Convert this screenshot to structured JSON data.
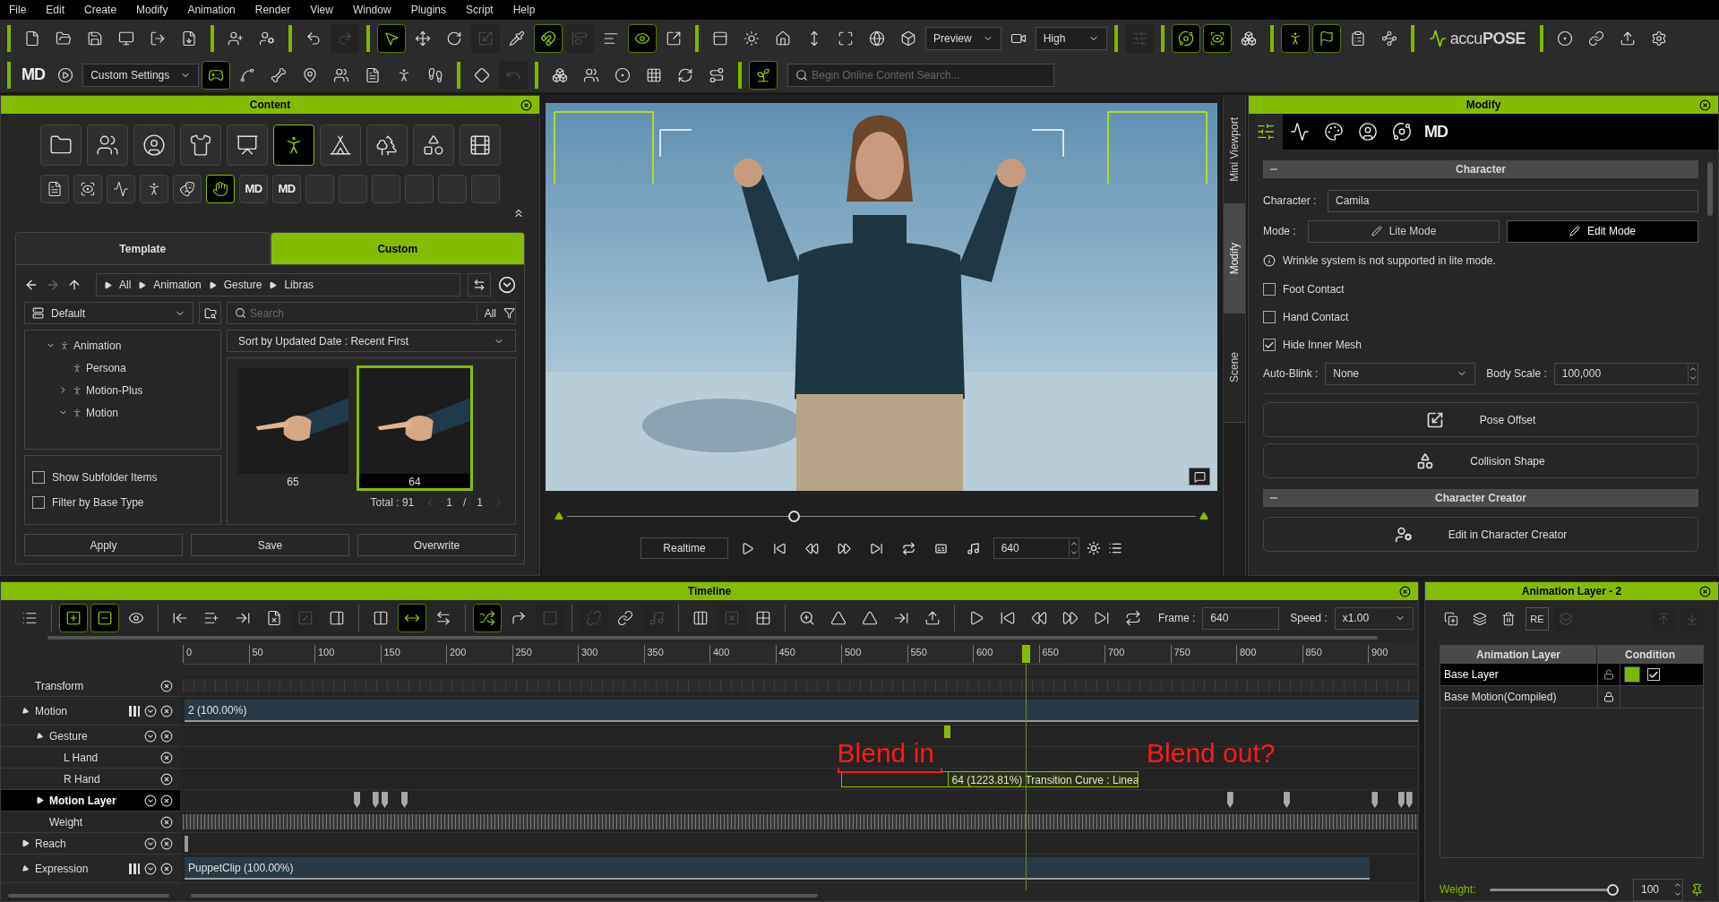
{
  "menu": [
    "File",
    "Edit",
    "Create",
    "Modify",
    "Animation",
    "Render",
    "View",
    "Window",
    "Plugins",
    "Script",
    "Help"
  ],
  "toolbar_1": [
    [
      {
        "kind": "icon",
        "on": false,
        "disabled": false
      },
      {
        "kind": "icon",
        "on": false,
        "disabled": false
      },
      {
        "kind": "icon",
        "on": false,
        "disabled": false
      },
      {
        "kind": "icon",
        "on": false,
        "disabled": false
      },
      {
        "kind": "icon",
        "on": false,
        "disabled": false
      },
      {
        "kind": "icon",
        "on": false,
        "disabled": false
      }
    ],
    [
      {
        "kind": "icon",
        "on": false,
        "disabled": false
      },
      {
        "kind": "icon",
        "on": false,
        "disabled": false
      }
    ],
    [
      {
        "kind": "icon",
        "on": false,
        "disabled": false
      },
      {
        "kind": "icon",
        "on": false,
        "disabled": true
      }
    ],
    [
      {
        "kind": "icon",
        "on": true,
        "disabled": false
      },
      {
        "kind": "icon",
        "on": false,
        "disabled": false
      },
      {
        "kind": "icon",
        "on": false,
        "disabled": false
      },
      {
        "kind": "icon",
        "on": false,
        "disabled": true
      },
      {
        "kind": "icon",
        "on": false,
        "disabled": false
      },
      {
        "kind": "icon",
        "on": true,
        "disabled": false
      },
      {
        "kind": "icon",
        "on": false,
        "disabled": true
      },
      {
        "kind": "icon",
        "on": false,
        "disabled": false
      },
      {
        "kind": "icon",
        "on": true,
        "disabled": false
      },
      {
        "kind": "icon",
        "on": false,
        "disabled": false
      }
    ],
    [
      {
        "kind": "icon",
        "on": false,
        "disabled": false
      },
      {
        "kind": "icon",
        "on": false,
        "disabled": false
      },
      {
        "kind": "icon",
        "on": false,
        "disabled": false
      },
      {
        "kind": "icon",
        "on": false,
        "disabled": false
      },
      {
        "kind": "icon",
        "on": false,
        "disabled": false
      },
      {
        "kind": "icon",
        "on": false,
        "disabled": false
      },
      {
        "kind": "icon",
        "on": false,
        "disabled": false
      },
      {
        "kind": "dropdown",
        "value": "Preview"
      },
      {
        "kind": "icon",
        "on": false,
        "disabled": false
      },
      {
        "kind": "dropdown",
        "value": "High"
      }
    ],
    [
      {
        "kind": "icon",
        "on": false,
        "disabled": true
      }
    ],
    [
      {
        "kind": "icon",
        "on": true,
        "disabled": false
      },
      {
        "kind": "icon",
        "on": true,
        "disabled": false
      },
      {
        "kind": "icon",
        "on": false,
        "disabled": false
      }
    ],
    [
      {
        "kind": "icon",
        "on": true,
        "disabled": false
      },
      {
        "kind": "icon",
        "on": true,
        "disabled": false
      },
      {
        "kind": "icon",
        "on": false,
        "disabled": false
      },
      {
        "kind": "icon",
        "on": false,
        "disabled": false
      }
    ],
    [
      {
        "kind": "logo",
        "value": "accu**POSE**"
      }
    ],
    [
      {
        "kind": "icon",
        "on": false,
        "disabled": false
      },
      {
        "kind": "icon",
        "on": false,
        "disabled": false
      },
      {
        "kind": "icon",
        "on": false,
        "disabled": false
      },
      {
        "kind": "icon",
        "on": false,
        "disabled": false
      }
    ]
  ],
  "toolbar_2": [
    [
      {
        "kind": "label",
        "value": "MD"
      },
      {
        "kind": "icon",
        "on": false,
        "disabled": false
      },
      {
        "kind": "dropdown",
        "value": "Custom Settings"
      },
      {
        "kind": "icon",
        "on": true,
        "disabled": false
      },
      {
        "kind": "icon",
        "on": false,
        "disabled": false
      },
      {
        "kind": "icon",
        "on": false,
        "disabled": false
      },
      {
        "kind": "icon",
        "on": false,
        "disabled": false
      },
      {
        "kind": "icon",
        "on": false,
        "disabled": false
      },
      {
        "kind": "icon",
        "on": false,
        "disabled": false
      },
      {
        "kind": "icon",
        "on": false,
        "disabled": false
      },
      {
        "kind": "icon",
        "on": false,
        "disabled": false
      }
    ],
    [
      {
        "kind": "icon",
        "on": false,
        "disabled": false
      },
      {
        "kind": "icon",
        "on": false,
        "disabled": true
      }
    ],
    [
      {
        "kind": "icon",
        "on": false,
        "disabled": false
      },
      {
        "kind": "icon",
        "on": false,
        "disabled": false
      },
      {
        "kind": "icon",
        "on": false,
        "disabled": false
      },
      {
        "kind": "icon",
        "on": false,
        "disabled": false
      },
      {
        "kind": "icon",
        "on": false,
        "disabled": false
      },
      {
        "kind": "icon",
        "on": false,
        "disabled": false
      }
    ],
    [
      {
        "kind": "icon",
        "on": true,
        "disabled": false
      },
      {
        "kind": "search",
        "placeholder": "Begin Online Content Search..."
      }
    ]
  ],
  "content": {
    "title": "Content",
    "categories": [
      {
        "selected": false
      },
      {
        "selected": false
      },
      {
        "selected": false
      },
      {
        "selected": false
      },
      {
        "selected": false
      },
      {
        "selected": true
      },
      {
        "selected": false
      },
      {
        "selected": false
      },
      {
        "selected": false
      },
      {
        "selected": false
      }
    ],
    "subcategories": [
      {
        "kind": "icon",
        "selected": false
      },
      {
        "kind": "icon",
        "selected": false
      },
      {
        "kind": "icon",
        "selected": false
      },
      {
        "kind": "icon",
        "selected": false
      },
      {
        "kind": "icon",
        "selected": false
      },
      {
        "kind": "icon",
        "selected": true
      },
      {
        "kind": "label",
        "label": "MD",
        "selected": false
      },
      {
        "kind": "label",
        "label": "MD",
        "selected": false
      },
      {
        "kind": "empty",
        "selected": false
      },
      {
        "kind": "empty",
        "selected": false
      },
      {
        "kind": "empty",
        "selected": false
      },
      {
        "kind": "empty",
        "selected": false
      },
      {
        "kind": "empty",
        "selected": false
      },
      {
        "kind": "empty",
        "selected": false
      }
    ],
    "tabs": [
      {
        "label": "Template",
        "selected": false
      },
      {
        "label": "Custom",
        "selected": true
      }
    ],
    "breadcrumb": [
      "All",
      "Animation",
      "Gesture",
      "Libras"
    ],
    "library": "Default",
    "search": {
      "placeholder": "Search",
      "filter": "All"
    },
    "tree": [
      {
        "label": "Animation",
        "expandable": true,
        "expanded": true,
        "children": [
          {
            "label": "Persona",
            "expandable": false
          },
          {
            "label": "Motion-Plus",
            "expandable": true,
            "expanded": false
          },
          {
            "label": "Motion",
            "expandable": true,
            "expanded": true
          }
        ]
      }
    ],
    "sort": "Sort by Updated Date : Recent First",
    "items": [
      {
        "label": "65",
        "selected": false
      },
      {
        "label": "64",
        "selected": true
      }
    ],
    "total": "Total : 91",
    "pager": {
      "page": "1",
      "separator": "/",
      "pages": "1"
    },
    "options": [
      {
        "label": "Show Subfolder Items",
        "checked": false
      },
      {
        "label": "Filter by Base Type",
        "checked": false
      }
    ],
    "buttons": [
      "Apply",
      "Save",
      "Overwrite"
    ]
  },
  "viewport": {
    "scrubber": {
      "level": 0.36
    },
    "realtime": "Realtime",
    "frame": "640"
  },
  "side_tabs": [
    {
      "label": "Mini Viewport",
      "selected": false
    },
    {
      "label": "Modify",
      "selected": true
    },
    {
      "label": "Scene",
      "selected": false
    }
  ],
  "modify": {
    "title": "Modify",
    "tabs": [
      {
        "kind": "icon",
        "selected": true
      },
      {
        "kind": "icon",
        "selected": false
      },
      {
        "kind": "icon",
        "selected": false
      },
      {
        "kind": "icon",
        "selected": false
      },
      {
        "kind": "icon",
        "selected": false
      },
      {
        "kind": "label",
        "label": "MD",
        "selected": false
      }
    ],
    "character_section": {
      "title": "Character",
      "character_label": "Character :",
      "character": "Camila",
      "mode_label": "Mode :",
      "modes": [
        {
          "label": "Lite Mode",
          "selected": false
        },
        {
          "label": "Edit Mode",
          "selected": true
        }
      ],
      "info": "Wrinkle system is not supported in lite mode.",
      "options": [
        {
          "label": "Foot Contact",
          "checked": false
        },
        {
          "label": "Hand Contact",
          "checked": false
        },
        {
          "label": "Hide Inner Mesh",
          "checked": true
        }
      ],
      "auto_blink_label": "Auto-Blink :",
      "auto_blink": "None",
      "body_scale_label": "Body Scale :",
      "body_scale": "100,000",
      "buttons": [
        "Pose Offset",
        "Collision Shape"
      ]
    },
    "creator_section": {
      "title": "Character Creator",
      "button": "Edit in Character Creator"
    }
  },
  "timeline": {
    "title": "Timeline",
    "toolbar": [
      [
        {
          "kind": "icon",
          "on": false,
          "disabled": false
        }
      ],
      [
        {
          "kind": "icon",
          "on": true,
          "disabled": false
        },
        {
          "kind": "icon",
          "on": true,
          "disabled": false
        },
        {
          "kind": "icon",
          "on": false,
          "disabled": false
        }
      ],
      [
        {
          "kind": "icon",
          "on": false,
          "disabled": false
        },
        {
          "kind": "icon",
          "on": false,
          "disabled": false
        },
        {
          "kind": "icon",
          "on": false,
          "disabled": false
        },
        {
          "kind": "icon",
          "on": false,
          "disabled": false
        },
        {
          "kind": "icon",
          "on": false,
          "disabled": true
        },
        {
          "kind": "icon",
          "on": false,
          "disabled": false
        }
      ],
      [
        {
          "kind": "icon",
          "on": false,
          "disabled": false
        },
        {
          "kind": "icon",
          "on": true,
          "disabled": false
        },
        {
          "kind": "icon",
          "on": false,
          "disabled": false
        }
      ],
      [
        {
          "kind": "icon",
          "on": true,
          "disabled": false
        },
        {
          "kind": "icon",
          "on": false,
          "disabled": false
        },
        {
          "kind": "icon",
          "on": false,
          "disabled": true
        }
      ],
      [
        {
          "kind": "icon",
          "on": false,
          "disabled": true
        },
        {
          "kind": "icon",
          "on": false,
          "disabled": false
        },
        {
          "kind": "icon",
          "on": false,
          "disabled": true
        }
      ],
      [
        {
          "kind": "icon",
          "on": false,
          "disabled": false
        },
        {
          "kind": "icon",
          "on": false,
          "disabled": true
        },
        {
          "kind": "icon",
          "on": false,
          "disabled": false
        }
      ],
      [
        {
          "kind": "icon",
          "on": false,
          "disabled": false
        },
        {
          "kind": "icon",
          "on": false,
          "disabled": false
        },
        {
          "kind": "icon",
          "on": false,
          "disabled": false
        },
        {
          "kind": "icon",
          "on": false,
          "disabled": false
        },
        {
          "kind": "icon",
          "on": false,
          "disabled": false
        }
      ],
      [
        {
          "kind": "icon",
          "on": false,
          "disabled": false
        },
        {
          "kind": "icon",
          "on": false,
          "disabled": false
        },
        {
          "kind": "icon",
          "on": false,
          "disabled": false
        },
        {
          "kind": "icon",
          "on": false,
          "disabled": false
        },
        {
          "kind": "icon",
          "on": false,
          "disabled": false
        },
        {
          "kind": "icon",
          "on": false,
          "disabled": false
        }
      ]
    ],
    "frame_label": "Frame :",
    "frame": "640",
    "speed_label": "Speed :",
    "speed": "x1.00",
    "ruler": [
      "0",
      "50",
      "100",
      "150",
      "200",
      "250",
      "300",
      "350",
      "400",
      "450",
      "500",
      "550",
      "600",
      "650",
      "700",
      "750",
      "800",
      "850",
      "900"
    ],
    "tracks": [
      {
        "label": "Transform",
        "kind": "keys",
        "expandable": false,
        "selected": false,
        "bars": false,
        "menu": false
      },
      {
        "label": "Motion",
        "kind": "clip",
        "clip": "2 (100.00%)",
        "expandable": true,
        "expanded": true,
        "selected": false,
        "bars": true,
        "menu": true,
        "children": [
          {
            "label": "Gesture",
            "kind": "marker",
            "expandable": true,
            "expanded": true,
            "selected": false,
            "bars": false,
            "menu": true,
            "children": [
              {
                "label": "L Hand",
                "kind": "empty",
                "expandable": false,
                "selected": false,
                "bars": false,
                "menu": false
              },
              {
                "label": "R Hand",
                "kind": "transition",
                "clip": "64 (1223.81%) Transition Curve : Linea",
                "expandable": false,
                "selected": false,
                "bars": false,
                "menu": false
              }
            ]
          },
          {
            "label": "Motion Layer",
            "kind": "keyframes",
            "expandable": true,
            "expanded": false,
            "selected": true,
            "bars": false,
            "menu": true
          },
          {
            "label": "Weight",
            "kind": "weights",
            "expandable": false,
            "selected": false,
            "bars": false,
            "menu": false
          }
        ]
      },
      {
        "label": "Reach",
        "kind": "start",
        "expandable": true,
        "expanded": false,
        "selected": false,
        "bars": false,
        "menu": true
      },
      {
        "label": "Expression",
        "kind": "clip",
        "clip": "PuppetClip (100.00%)",
        "expandable": true,
        "expanded": true,
        "selected": false,
        "bars": true,
        "menu": true
      }
    ],
    "annotations": [
      {
        "kind": "bracket",
        "text": "Blend in"
      },
      {
        "kind": "plain",
        "text": "Blend out?"
      }
    ]
  },
  "animation_layer": {
    "title": "Animation Layer - 2",
    "toolbar": [
      {
        "kind": "icon",
        "on": false,
        "disabled": false
      },
      {
        "kind": "icon",
        "on": false,
        "disabled": false
      },
      {
        "kind": "icon",
        "on": false,
        "disabled": false
      },
      {
        "kind": "label",
        "value": "RE",
        "on": false,
        "disabled": false
      },
      {
        "kind": "icon",
        "on": false,
        "disabled": true
      },
      {
        "kind": "icon",
        "on": false,
        "disabled": true
      },
      {
        "kind": "icon",
        "on": false,
        "disabled": true
      }
    ],
    "columns": [
      "Animation Layer",
      "Condition"
    ],
    "rows": [
      {
        "name": "Base Layer",
        "selected": true,
        "locked": false,
        "color": "#7ab800",
        "checked": true
      },
      {
        "name": "Base Motion(Compiled)",
        "selected": false,
        "locked": true
      }
    ],
    "weight_label": "Weight:",
    "weight": {
      "level": 1
    },
    "weight_value": "100"
  }
}
